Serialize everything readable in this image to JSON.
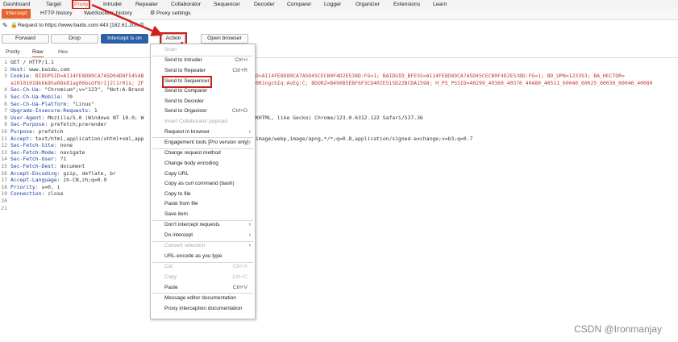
{
  "top_menu": [
    "Dashboard",
    "Target",
    "Proxy",
    "Intruder",
    "Repeater",
    "Collaborator",
    "Sequencer",
    "Decoder",
    "Comparer",
    "Logger",
    "Organizer",
    "Extensions",
    "Learn"
  ],
  "sub_tabs": [
    "Intercept",
    "HTTP history",
    "WebSockets history",
    "Proxy settings"
  ],
  "request_info": "Request to https://www.baidu.com:443  [182.61.200.7]",
  "buttons": {
    "forward": "Forward",
    "drop": "Drop",
    "intercept": "Intercept is on",
    "action": "Action",
    "open_browser": "Open browser"
  },
  "editor_tabs": [
    "Pretty",
    "Raw",
    "Hex"
  ],
  "request_lines": [
    {
      "n": "1",
      "text": "GET / HTTP/1.1",
      "t": "plain"
    },
    {
      "n": "2",
      "k": "Host",
      "v": " www.baidu.com",
      "t": "h"
    },
    {
      "n": "3",
      "k": "Cookie",
      "v": " BIDUPSID=A114FE8D89CA7A5D04D8F545AB",
      "rest": "D=A114FE8D89CA7A5D45CECB0F4D2E538D:FG=1; BAIDUID_BFESS=A114FE8D89CA7A5D45CECB0F4D2E538D:FG=1; BD_UPN=123353; BA_HECTOR=",
      "t": "cookie"
    },
    {
      "n": "",
      "text": "a10101018k6k8ha08k81ag00bsdf6r1j2l1r01s; ZF",
      "rest": "0R1ngchIq:AvEg:C; BDORZ=B490B5EBF6F3CD402E515D22BCDA1598; H_PS_PSSID=40299_40369_40376_40480_40511_60040_60025_60030_60046_40080",
      "t": "cont"
    },
    {
      "n": "4",
      "k": "Sec-Ch-Ua",
      "v": " \"Chromium\";v=\"123\", \"Not:A-Brand",
      "t": "h"
    },
    {
      "n": "5",
      "k": "Sec-Ch-Ua-Mobile",
      "v": " ?0",
      "t": "h"
    },
    {
      "n": "6",
      "k": "Sec-Ch-Ua-Platform",
      "v": " \"Linux\"",
      "t": "h"
    },
    {
      "n": "7",
      "k": "Upgrade-Insecure-Requests",
      "v": " 1",
      "t": "h"
    },
    {
      "n": "8",
      "k": "User-Agent",
      "v": " Mozilla/5.0 (Windows NT 10.0; W",
      "rest": "KHTML, like Gecko) Chrome/123.0.6312.122 Safari/537.36",
      "t": "h"
    },
    {
      "n": "9",
      "k": "Sec-Purpose",
      "v": " prefetch;prerender",
      "t": "h"
    },
    {
      "n": "10",
      "k": "Purpose",
      "v": " prefetch",
      "t": "h"
    },
    {
      "n": "11",
      "k": "Accept",
      "v": " text/html,application/xhtml+xml,app",
      "rest": "image/webp,image/apng,*/*;q=0.8,application/signed-exchange;v=b3;q=0.7",
      "t": "h"
    },
    {
      "n": "12",
      "k": "Sec-Fetch-Site",
      "v": " none",
      "t": "h"
    },
    {
      "n": "13",
      "k": "Sec-Fetch-Mode",
      "v": " navigate",
      "t": "h"
    },
    {
      "n": "14",
      "k": "Sec-Fetch-User",
      "v": " ?1",
      "t": "h"
    },
    {
      "n": "15",
      "k": "Sec-Fetch-Dest",
      "v": " document",
      "t": "h"
    },
    {
      "n": "16",
      "k": "Accept-Encoding",
      "v": " gzip, deflate, br",
      "t": "h"
    },
    {
      "n": "17",
      "k": "Accept-Language",
      "v": " zh-CN,zh;q=0.9",
      "t": "h"
    },
    {
      "n": "18",
      "k": "Priority",
      "v": " u=0, i",
      "t": "h"
    },
    {
      "n": "19",
      "k": "Connection",
      "v": " close",
      "t": "h"
    },
    {
      "n": "20",
      "text": "",
      "t": "plain"
    },
    {
      "n": "21",
      "text": "",
      "t": "plain"
    }
  ],
  "context_menu": [
    {
      "label": "Scan",
      "shortcut": "",
      "disabled": true,
      "sep_after": true
    },
    {
      "label": "Send to Intruder",
      "shortcut": "Ctrl+I"
    },
    {
      "label": "Send to Repeater",
      "shortcut": "Ctrl+R"
    },
    {
      "label": "Send to Sequencer",
      "shortcut": "",
      "highlight": true
    },
    {
      "label": "Send to Comparer",
      "shortcut": ""
    },
    {
      "label": "Send to Decoder",
      "shortcut": ""
    },
    {
      "label": "Send to Organizer",
      "shortcut": "Ctrl+O"
    },
    {
      "label": "Insert Collaborator payload",
      "shortcut": "",
      "disabled": true
    },
    {
      "label": "Request in browser",
      "shortcut": "",
      "submenu": true,
      "sep_after": true
    },
    {
      "label": "Engagement tools [Pro version only]",
      "shortcut": "",
      "submenu": true,
      "sep_after": true
    },
    {
      "label": "Change request method",
      "shortcut": ""
    },
    {
      "label": "Change body encoding",
      "shortcut": ""
    },
    {
      "label": "Copy URL",
      "shortcut": ""
    },
    {
      "label": "Copy as curl command (bash)",
      "shortcut": ""
    },
    {
      "label": "Copy to file",
      "shortcut": ""
    },
    {
      "label": "Paste from file",
      "shortcut": ""
    },
    {
      "label": "Save item",
      "shortcut": "",
      "sep_after": true
    },
    {
      "label": "Don't intercept requests",
      "shortcut": "",
      "submenu": true
    },
    {
      "label": "Do intercept",
      "shortcut": "",
      "submenu": true,
      "sep_after": true
    },
    {
      "label": "Convert selection",
      "shortcut": "",
      "submenu": true,
      "disabled": true
    },
    {
      "label": "URL-encode as you type",
      "shortcut": "",
      "sep_after": true
    },
    {
      "label": "Cut",
      "shortcut": "Ctrl+X",
      "disabled": true
    },
    {
      "label": "Copy",
      "shortcut": "Ctrl+C",
      "disabled": true
    },
    {
      "label": "Paste",
      "shortcut": "Ctrl+V",
      "sep_after": true
    },
    {
      "label": "Message editor documentation",
      "shortcut": ""
    },
    {
      "label": "Proxy interception documentation",
      "shortcut": ""
    }
  ],
  "watermark": "CSDN @Ironmanjay",
  "colors": {
    "accent": "#e8632b",
    "intercept_blue": "#2d5fa8",
    "annotation_red": "#d0201e"
  }
}
